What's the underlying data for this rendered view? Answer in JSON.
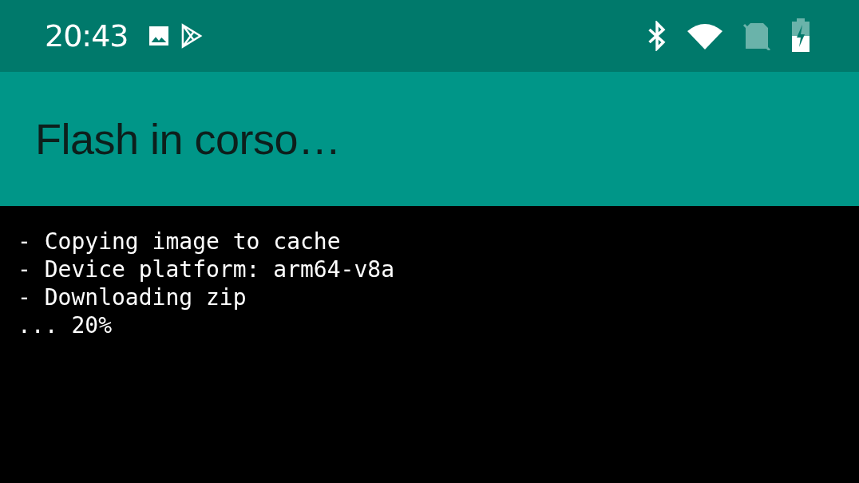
{
  "status_bar": {
    "time": "20:43"
  },
  "app_bar": {
    "title": "Flash in corso…"
  },
  "console": {
    "lines": [
      "- Copying image to cache",
      "- Device platform: arm64-v8a",
      "- Downloading zip",
      "... 20%"
    ]
  }
}
